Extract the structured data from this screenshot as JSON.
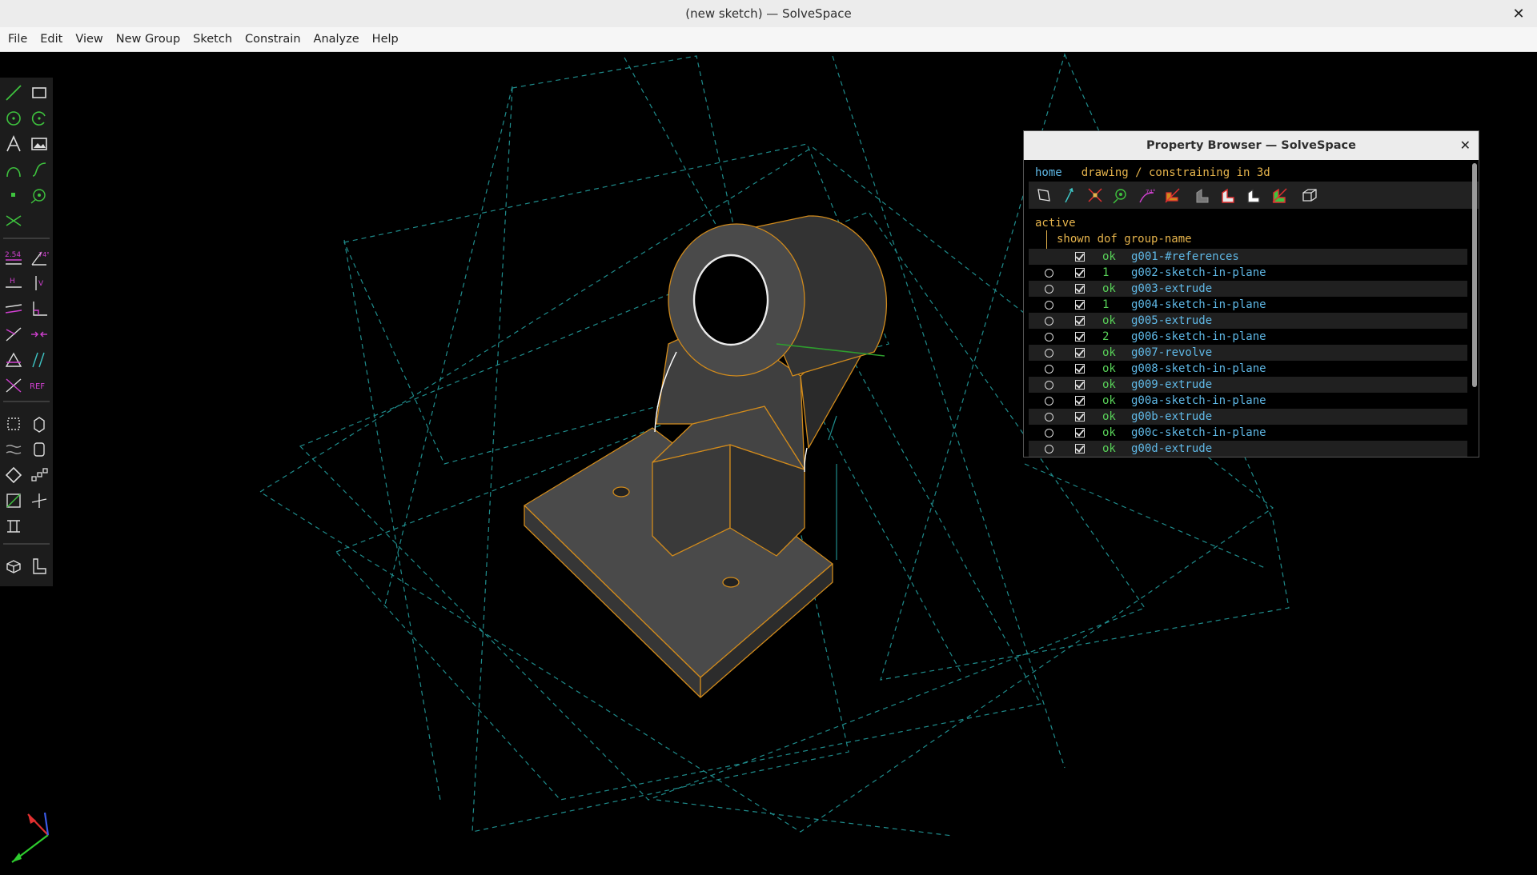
{
  "window": {
    "title": "(new sketch) — SolveSpace",
    "close_glyph": "✕"
  },
  "menu": [
    "File",
    "Edit",
    "View",
    "New Group",
    "Sketch",
    "Constrain",
    "Analyze",
    "Help"
  ],
  "toolbar": {
    "tools": [
      {
        "name": "line-icon"
      },
      {
        "name": "rectangle-icon"
      },
      {
        "name": "circle-icon"
      },
      {
        "name": "arc-icon"
      },
      {
        "name": "text-icon"
      },
      {
        "name": "image-icon"
      },
      {
        "name": "tangent-arc-icon"
      },
      {
        "name": "bezier-icon"
      },
      {
        "name": "point-icon"
      },
      {
        "name": "workplane-icon"
      },
      {
        "name": "construction-icon"
      },
      {
        "name": "distance-icon",
        "label": "2.54"
      },
      {
        "name": "angle-icon",
        "label": "74°"
      },
      {
        "name": "horizontal-icon",
        "label": "H"
      },
      {
        "name": "vertical-icon",
        "label": "V"
      },
      {
        "name": "parallel-icon"
      },
      {
        "name": "perpendicular-icon"
      },
      {
        "name": "on-point-icon"
      },
      {
        "name": "midpoint-icon"
      },
      {
        "name": "symmetric-icon"
      },
      {
        "name": "same-orientation-icon"
      },
      {
        "name": "other-angle-icon"
      },
      {
        "name": "reference-icon",
        "label": "REF"
      },
      {
        "name": "new-3d-group-icon"
      },
      {
        "name": "step-icon"
      },
      {
        "name": "helix-icon"
      },
      {
        "name": "lathe-icon"
      },
      {
        "name": "step-rotate-icon"
      },
      {
        "name": "step-translate-icon"
      },
      {
        "name": "workplane-group-icon"
      },
      {
        "name": "nearest-iso-icon"
      },
      {
        "name": "trim-icon"
      },
      {
        "name": "assembly-icon"
      },
      {
        "name": "l-shape-icon"
      }
    ]
  },
  "property_browser": {
    "title": "Property Browser — SolveSpace",
    "close_glyph": "✕",
    "nav_home": "home",
    "nav_mode": "drawing / constraining in 3d",
    "col_active": "active",
    "col_headers": "shown dof group-name",
    "groups": [
      {
        "radio": false,
        "dof": "ok",
        "name": "g001-#references"
      },
      {
        "radio": true,
        "dof": "1",
        "name": "g002-sketch-in-plane"
      },
      {
        "radio": true,
        "dof": "ok",
        "name": "g003-extrude"
      },
      {
        "radio": true,
        "dof": "1",
        "name": "g004-sketch-in-plane"
      },
      {
        "radio": true,
        "dof": "ok",
        "name": "g005-extrude"
      },
      {
        "radio": true,
        "dof": "2",
        "name": "g006-sketch-in-plane"
      },
      {
        "radio": true,
        "dof": "ok",
        "name": "g007-revolve"
      },
      {
        "radio": true,
        "dof": "ok",
        "name": "g008-sketch-in-plane"
      },
      {
        "radio": true,
        "dof": "ok",
        "name": "g009-extrude"
      },
      {
        "radio": true,
        "dof": "ok",
        "name": "g00a-sketch-in-plane"
      },
      {
        "radio": true,
        "dof": "ok",
        "name": "g00b-extrude"
      },
      {
        "radio": true,
        "dof": "ok",
        "name": "g00c-sketch-in-plane"
      },
      {
        "radio": true,
        "dof": "ok",
        "name": "g00d-extrude"
      }
    ]
  },
  "colors": {
    "background": "#000000",
    "part_face": "#4a4a4a",
    "part_edge": "#d08a1c",
    "construction": "#1f8c8c",
    "link": "#5fb8e6",
    "header": "#e6b44c",
    "ok": "#58d058"
  }
}
